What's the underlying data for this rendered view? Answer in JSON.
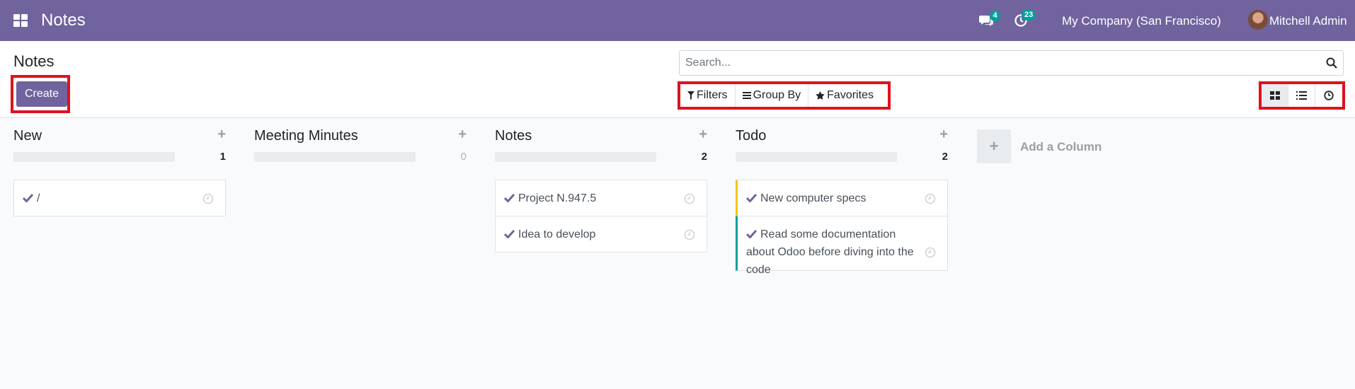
{
  "navbar": {
    "app_title": "Notes",
    "messages_count": "4",
    "activities_count": "23",
    "company": "My Company (San Francisco)",
    "user": "Mitchell Admin"
  },
  "control_panel": {
    "title": "Notes",
    "create_label": "Create",
    "search_placeholder": "Search...",
    "filters_label": "Filters",
    "group_by_label": "Group By",
    "favorites_label": "Favorites",
    "views": [
      "kanban",
      "list",
      "activity"
    ],
    "active_view": "kanban"
  },
  "columns": [
    {
      "title": "New",
      "count": "1",
      "cards": [
        {
          "text": "/"
        }
      ]
    },
    {
      "title": "Meeting Minutes",
      "count": "0",
      "cards": []
    },
    {
      "title": "Notes",
      "count": "2",
      "cards": [
        {
          "text": "Project N.947.5"
        },
        {
          "text": "Idea to develop"
        }
      ]
    },
    {
      "title": "Todo",
      "count": "2",
      "cards": [
        {
          "text": "New computer specs",
          "color": "#f0c419"
        },
        {
          "text": "Read some documentation about Odoo before diving into the code",
          "color": "#00a09d"
        }
      ]
    }
  ],
  "add_column_label": "Add a Column",
  "colors": {
    "brand": "#71639e",
    "badge": "#00a09d",
    "highlight_border": "#e0111e"
  }
}
